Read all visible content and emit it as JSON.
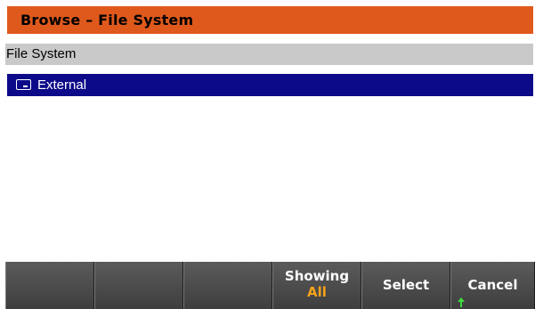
{
  "dialog": {
    "title": "Browse – File System",
    "path": "File System"
  },
  "file_list": {
    "items": [
      {
        "label": "External",
        "icon": "drive-icon",
        "selected": true
      }
    ]
  },
  "softkeys": {
    "showing_label": "Showing",
    "showing_value": "All",
    "select_label": "Select",
    "cancel_label": "Cancel"
  },
  "colors": {
    "title_bar": "#e0591c",
    "path_bar": "#c9c9c9",
    "selection": "#0d0a8a",
    "softkey_value": "#f5a21a",
    "indicator_arrow": "#3ddc3d"
  }
}
